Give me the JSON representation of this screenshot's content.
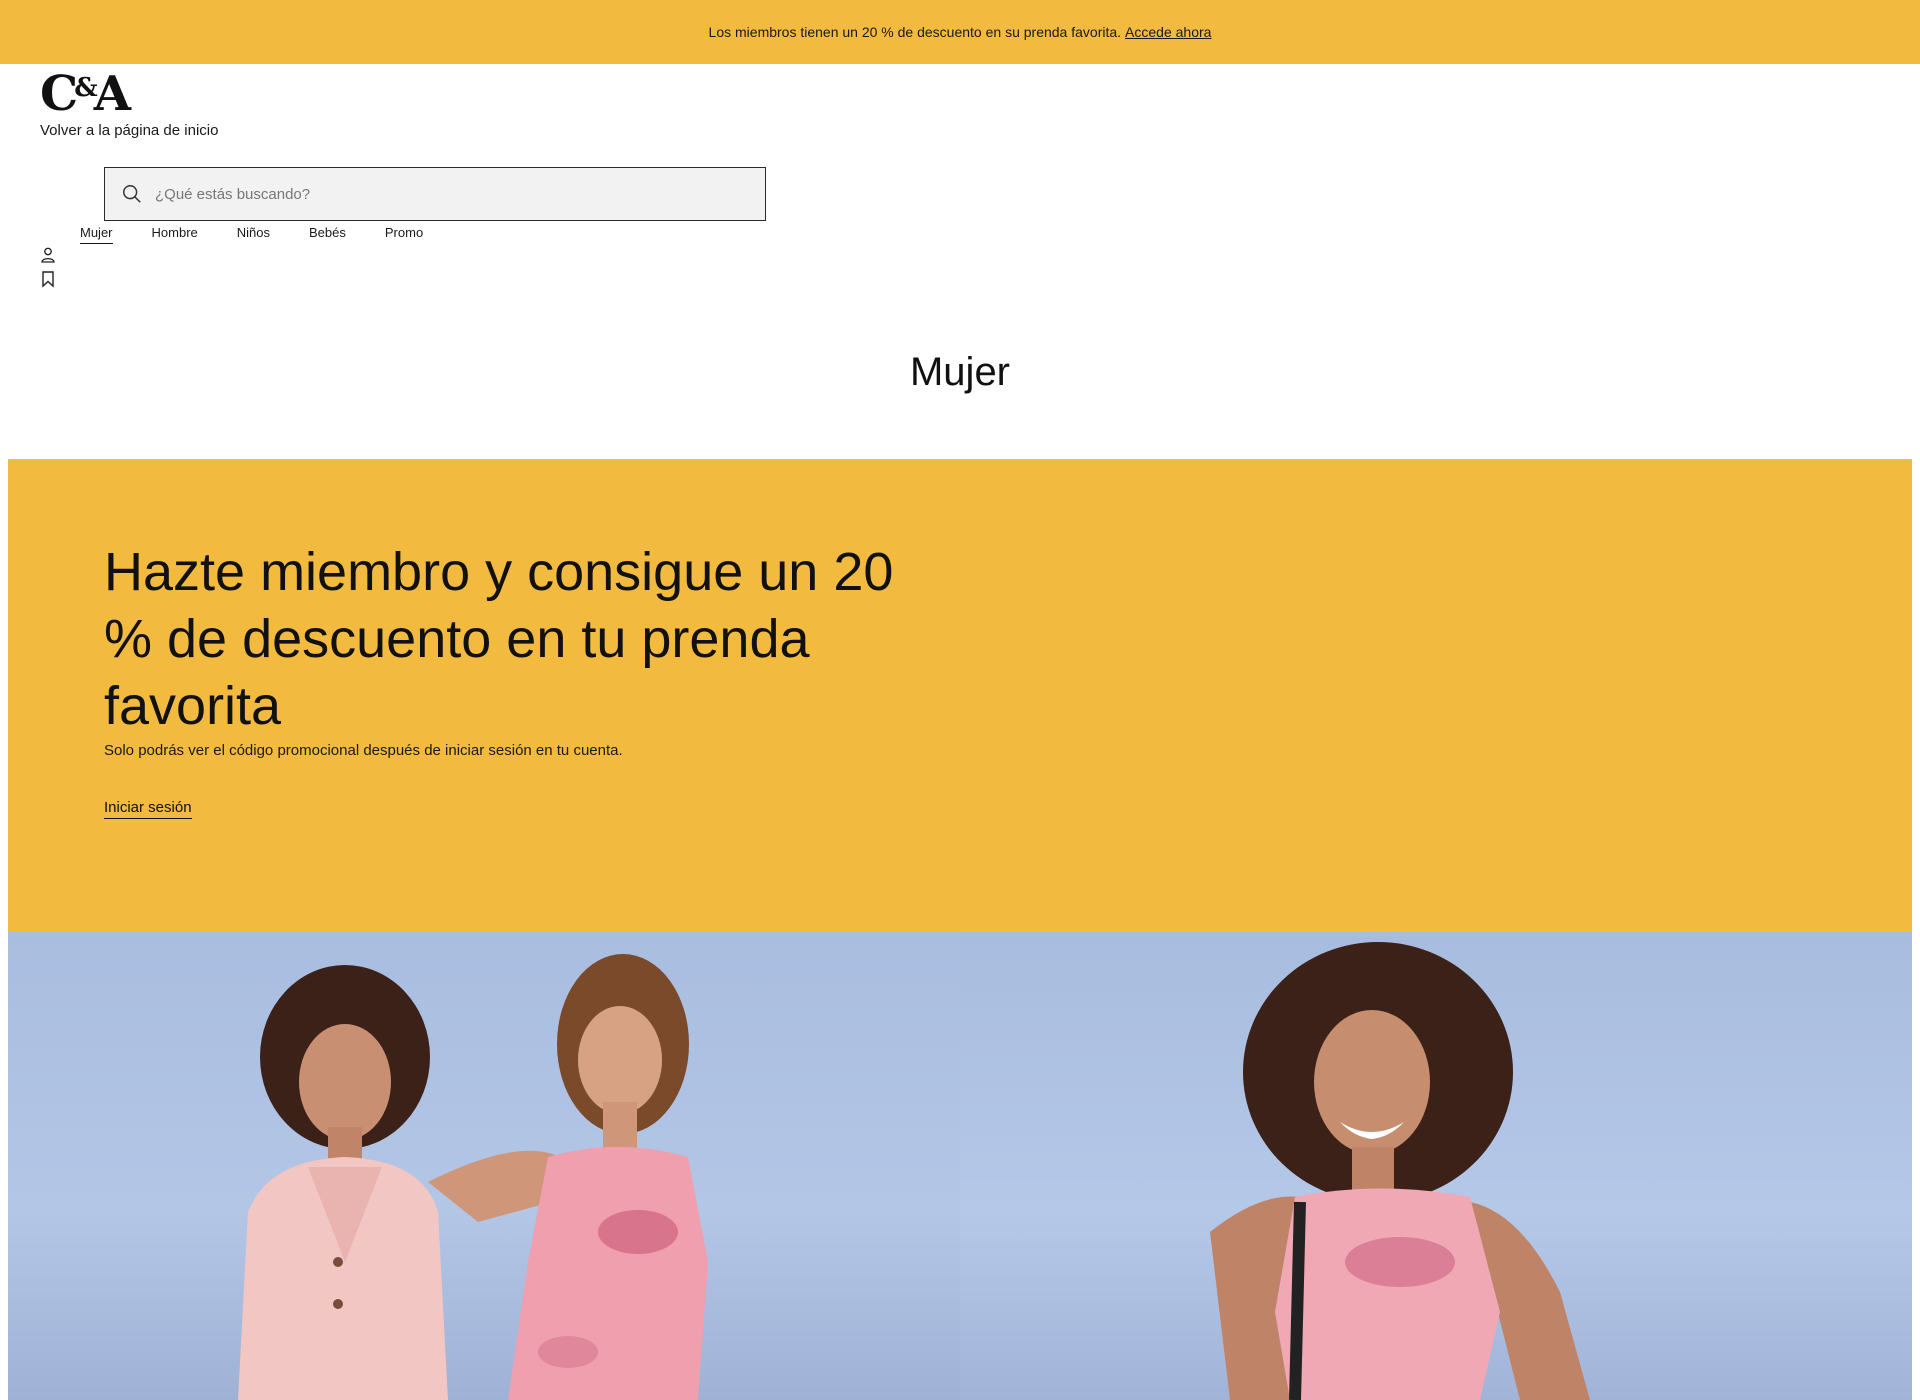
{
  "promo": {
    "text": "Los miembros tienen un 20 % de descuento en su prenda favorita.",
    "link": "Accede ahora"
  },
  "header": {
    "logo_c": "C",
    "logo_amp": "&",
    "logo_a": "A",
    "home_link": "Volver a la página de inicio",
    "search_placeholder": "¿Qué estás buscando?"
  },
  "nav": {
    "items": [
      {
        "label": "Mujer",
        "active": true
      },
      {
        "label": "Hombre"
      },
      {
        "label": "Niños"
      },
      {
        "label": "Bebés"
      },
      {
        "label": "Promo"
      }
    ]
  },
  "icons": {
    "search": "search-icon",
    "user": "user-icon",
    "bookmark": "bookmark-icon"
  },
  "page": {
    "title": "Mujer"
  },
  "hero": {
    "title": "Hazte miembro y consigue un 20 % de descuento en tu prenda favorita",
    "subtitle": "Solo podrás ver el código promocional después de iniciar sesión en tu cuenta.",
    "cta": "Iniciar sesión"
  },
  "colors": {
    "accent": "#f2bb40",
    "image_background": "#adc0e2"
  }
}
